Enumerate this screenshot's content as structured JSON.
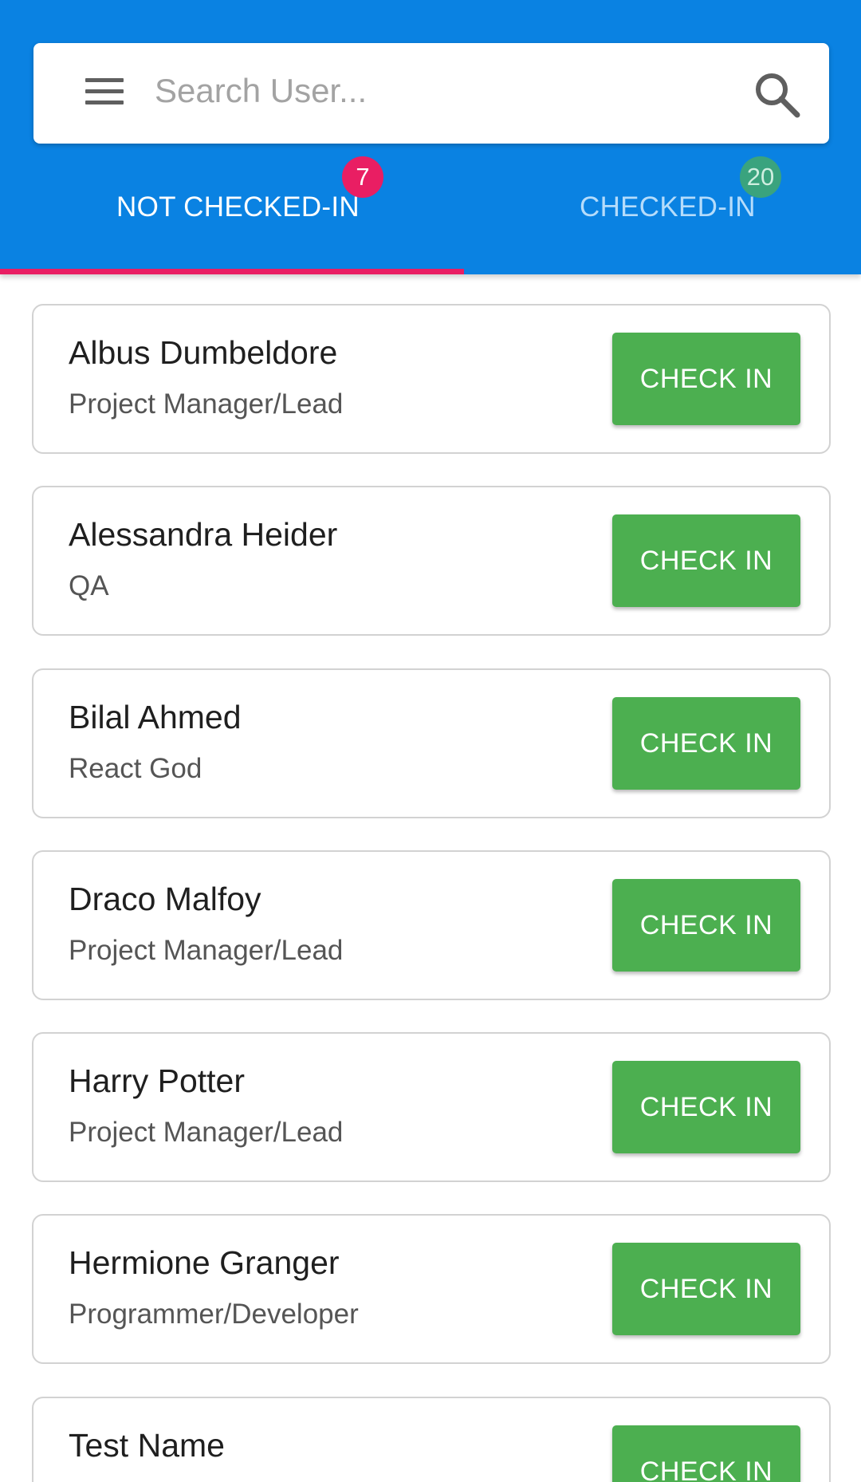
{
  "search": {
    "placeholder": "Search User...",
    "menu_icon": "hamburger-menu-icon",
    "search_icon": "magnifier-icon"
  },
  "tabs": [
    {
      "label": "NOT CHECKED-IN",
      "badge": "7",
      "badge_color": "#e91e63",
      "active": true
    },
    {
      "label": "CHECKED-IN",
      "badge": "20",
      "badge_color": "#3aa37e",
      "active": false
    }
  ],
  "colors": {
    "header": "#0a82e2",
    "indicator": "#e91e63",
    "button": "#4caf50",
    "active_tab_text": "#ffffff",
    "inactive_tab_text": "#b5dcfb"
  },
  "users": [
    {
      "name": "Albus Dumbeldore",
      "role": "Project Manager/Lead",
      "action": "CHECK IN"
    },
    {
      "name": "Alessandra Heider",
      "role": "QA",
      "action": "CHECK IN"
    },
    {
      "name": "Bilal Ahmed",
      "role": "React God",
      "action": "CHECK IN"
    },
    {
      "name": "Draco Malfoy",
      "role": "Project Manager/Lead",
      "action": "CHECK IN"
    },
    {
      "name": "Harry Potter",
      "role": "Project Manager/Lead",
      "action": "CHECK IN"
    },
    {
      "name": "Hermione Granger",
      "role": "Programmer/Developer",
      "action": "CHECK IN"
    },
    {
      "name": "Test Name",
      "role": "",
      "action": "CHECK IN"
    }
  ]
}
